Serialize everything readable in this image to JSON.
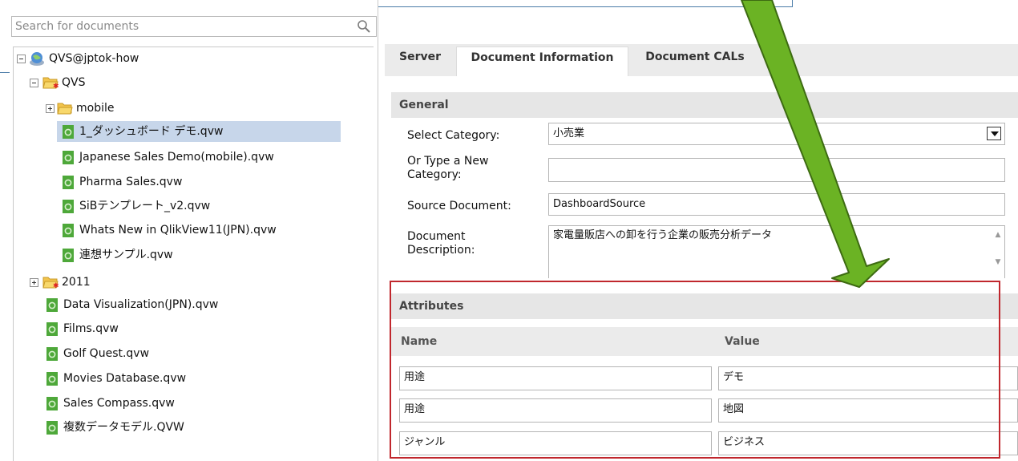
{
  "search": {
    "placeholder": "Search for documents"
  },
  "tree": {
    "root": "QVS@jptok-how",
    "folders": {
      "qvs": "QVS",
      "mobile": "mobile",
      "y2011": "2011"
    },
    "qvs_docs": [
      "1_ダッシュボード デモ.qvw",
      "Japanese Sales Demo(mobile).qvw",
      "Pharma Sales.qvw",
      "SiBテンプレート_v2.qvw",
      "Whats New in QlikView11(JPN).qvw",
      "連想サンプル.qvw"
    ],
    "root_docs": [
      "Data Visualization(JPN).qvw",
      "Films.qvw",
      "Golf Quest.qvw",
      "Movies Database.qvw",
      "Sales Compass.qvw",
      "複数データモデル.QVW"
    ]
  },
  "tabs": {
    "server": "Server",
    "document_information": "Document Information",
    "document_cals": "Document CALs"
  },
  "general": {
    "header": "General",
    "select_category_label": "Select Category:",
    "select_category_value": "小売業",
    "new_category_label_1": "Or Type a New",
    "new_category_label_2": "Category:",
    "new_category_value": "",
    "source_document_label": "Source Document:",
    "source_document_value": "DashboardSource",
    "description_label_1": "Document",
    "description_label_2": "Description:",
    "description_value": "家電量販店への卸を行う企業の販売分析データ"
  },
  "attributes": {
    "header": "Attributes",
    "name_header": "Name",
    "value_header": "Value",
    "rows": [
      {
        "name": "用途",
        "value": "デモ"
      },
      {
        "name": "用途",
        "value": "地図"
      },
      {
        "name": "ジャンル",
        "value": "ビジネス"
      }
    ]
  },
  "colors": {
    "highlight": "#c0272d",
    "arrow": "#6bb324",
    "selected_row": "#c7d6ea"
  }
}
